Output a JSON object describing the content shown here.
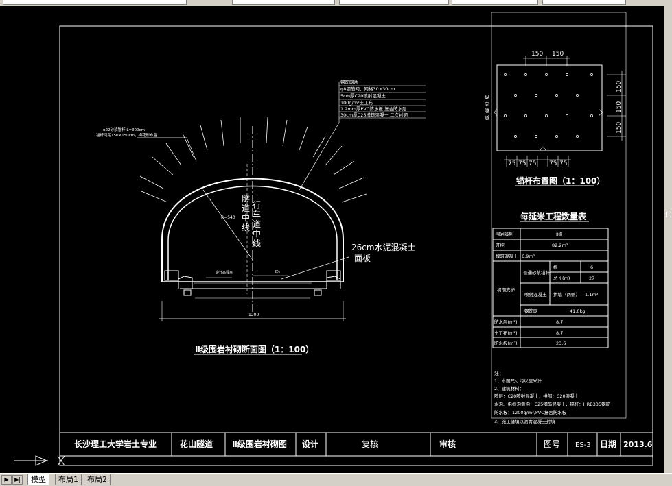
{
  "tabs": [
    {
      "label": "模型",
      "active": true
    },
    {
      "label": "布局1",
      "active": false
    },
    {
      "label": "布局2",
      "active": false
    }
  ],
  "drawing": {
    "section_labels": {
      "tunnel_centerline": "隧道中线",
      "lane_centerline": "行车道中线",
      "pavement_1": "26cm水泥混凝土",
      "pavement_2": "面板",
      "radius": "R=540",
      "design_elev": "设计高程点",
      "slope": "2%",
      "width_dim": "1200",
      "bolt_note_1": "φ22砂浆锚杆 L=300cm",
      "bolt_note_2": "锚杆间距150×150cm，梅花形布置"
    },
    "lining_callouts": [
      "钢筋网片",
      "φ8钢筋网，网格30×30cm",
      "5cm厚C20喷射混凝土",
      "100g/m²土工布",
      "1.2mm厚PVC防水板  复合防水层",
      "30cm厚C25模筑混凝土  二次衬砌"
    ],
    "section_title": "Ⅱ级围岩衬砌断面图（1：100）",
    "bolt_layout": {
      "title": "锚杆布置图（1：100）",
      "side_label": "纵向隧道",
      "top_dims": [
        "150",
        "150"
      ],
      "right_dims": [
        "150",
        "150",
        "150"
      ],
      "bottom_dims": [
        "75",
        "75",
        "75",
        "75",
        "75"
      ]
    },
    "quantity_table": {
      "title": "每延米工程数量表",
      "rows": [
        [
          "围岩级别",
          "",
          "",
          "Ⅱ级"
        ],
        [
          "开挖",
          "",
          "",
          "82.2m³"
        ],
        [
          "模筑混凝土",
          "",
          "",
          "6.9m³"
        ],
        [
          "初期支护",
          "普通砂浆锚杆",
          "根",
          "6"
        ],
        [
          "",
          "",
          "总长(m)",
          "27"
        ],
        [
          "",
          "喷射混凝土",
          "拱墙（两侧）",
          "1.1m³"
        ],
        [
          "",
          "钢筋网",
          "",
          "41.0kg"
        ],
        [
          "防水层(m²)",
          "",
          "",
          "8.7"
        ],
        [
          "土工布(m²)",
          "",
          "",
          "8.7"
        ],
        [
          "防水板(m²)",
          "",
          "",
          "23.6"
        ]
      ]
    },
    "notes": {
      "heading": "注：",
      "lines": [
        "1、本图尺寸均以厘米计",
        "2、建筑材料：",
        "   喷层：C20喷射混凝土，拱部：C20混凝土",
        "   水沟、电缆沟侧沟：C25钢筋混凝土，锚杆：HRB335钢筋",
        "   防水板：1200g/m²,PVC复合防水板",
        "3、施工缝填以沥青混凝土封填"
      ]
    },
    "title_block": {
      "school": "长沙理工大学岩土专业",
      "project": "花山隧道",
      "drawing_name": "Ⅱ级围岩衬砌图",
      "design": "设计",
      "review": "复核",
      "approve": "审核",
      "drawing_no_label": "图号",
      "drawing_no": "ES-3",
      "date_label": "日期",
      "date": "2013.6"
    },
    "colors": {
      "line": "#ffffff",
      "background": "#000000",
      "ui": "#d4d0c8"
    }
  }
}
